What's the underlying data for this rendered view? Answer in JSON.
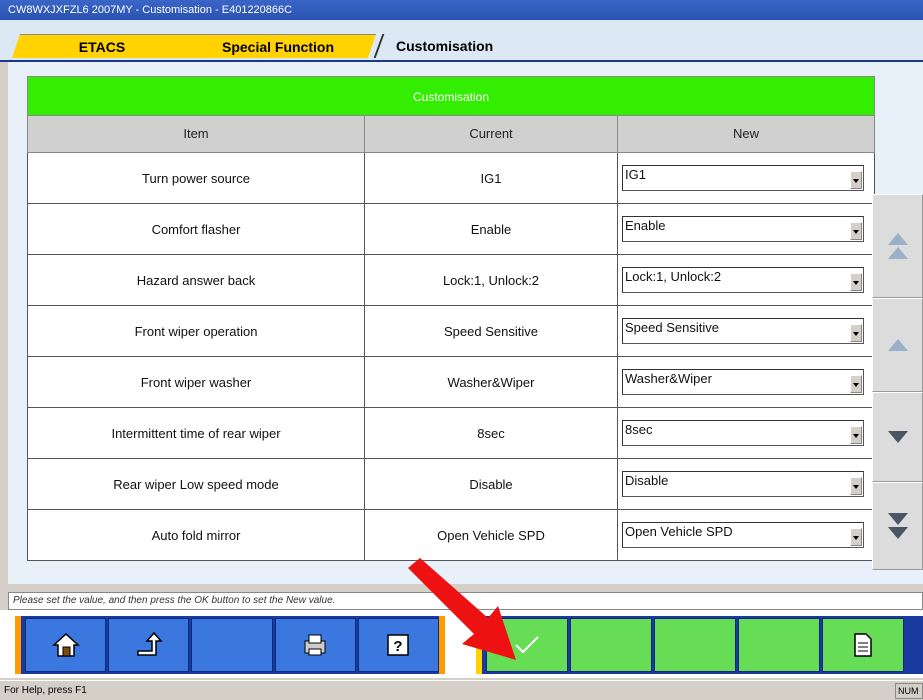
{
  "window": {
    "title": "CW8WXJXFZL6 2007MY   -  Customisation  -  E401220866C"
  },
  "tabs": {
    "etacs": "ETACS",
    "special": "Special Function",
    "custom": "Customisation"
  },
  "table": {
    "title": "Customisation",
    "headers": {
      "item": "Item",
      "current": "Current",
      "new": "New"
    },
    "rows": [
      {
        "item": "Turn power source",
        "current": "IG1",
        "new": "IG1"
      },
      {
        "item": "Comfort flasher",
        "current": "Enable",
        "new": "Enable"
      },
      {
        "item": "Hazard answer back",
        "current": "Lock:1, Unlock:2",
        "new": "Lock:1, Unlock:2"
      },
      {
        "item": "Front wiper operation",
        "current": "Speed Sensitive",
        "new": "Speed Sensitive"
      },
      {
        "item": "Front wiper washer",
        "current": "Washer&Wiper",
        "new": "Washer&Wiper"
      },
      {
        "item": "Intermittent time of rear wiper",
        "current": "8sec",
        "new": "8sec"
      },
      {
        "item": "Rear wiper Low speed mode",
        "current": "Disable",
        "new": "Disable"
      },
      {
        "item": "Auto fold mirror",
        "current": "Open Vehicle SPD",
        "new": "Open Vehicle SPD"
      }
    ]
  },
  "message": "Please set the value, and then press the OK button to set the New value.",
  "status": {
    "help": "For Help, press F1",
    "num": "NUM"
  },
  "icons": {
    "home": "home-icon",
    "back": "back-arrow-icon",
    "print": "printer-icon",
    "help": "help-icon",
    "ok": "checkmark-icon",
    "document": "document-icon",
    "scroll_top": "double-up-icon",
    "scroll_up": "up-icon",
    "scroll_down": "down-icon",
    "scroll_bottom": "double-down-icon"
  },
  "colors": {
    "title_bar": "#2a52b0",
    "table_title": "#33ee00",
    "toolbar": "#1a3aa0",
    "toolbar_button": "#3a78e0",
    "ok_button": "#66dd55",
    "tab": "#ffd200",
    "annotation_arrow": "#ee1111"
  }
}
